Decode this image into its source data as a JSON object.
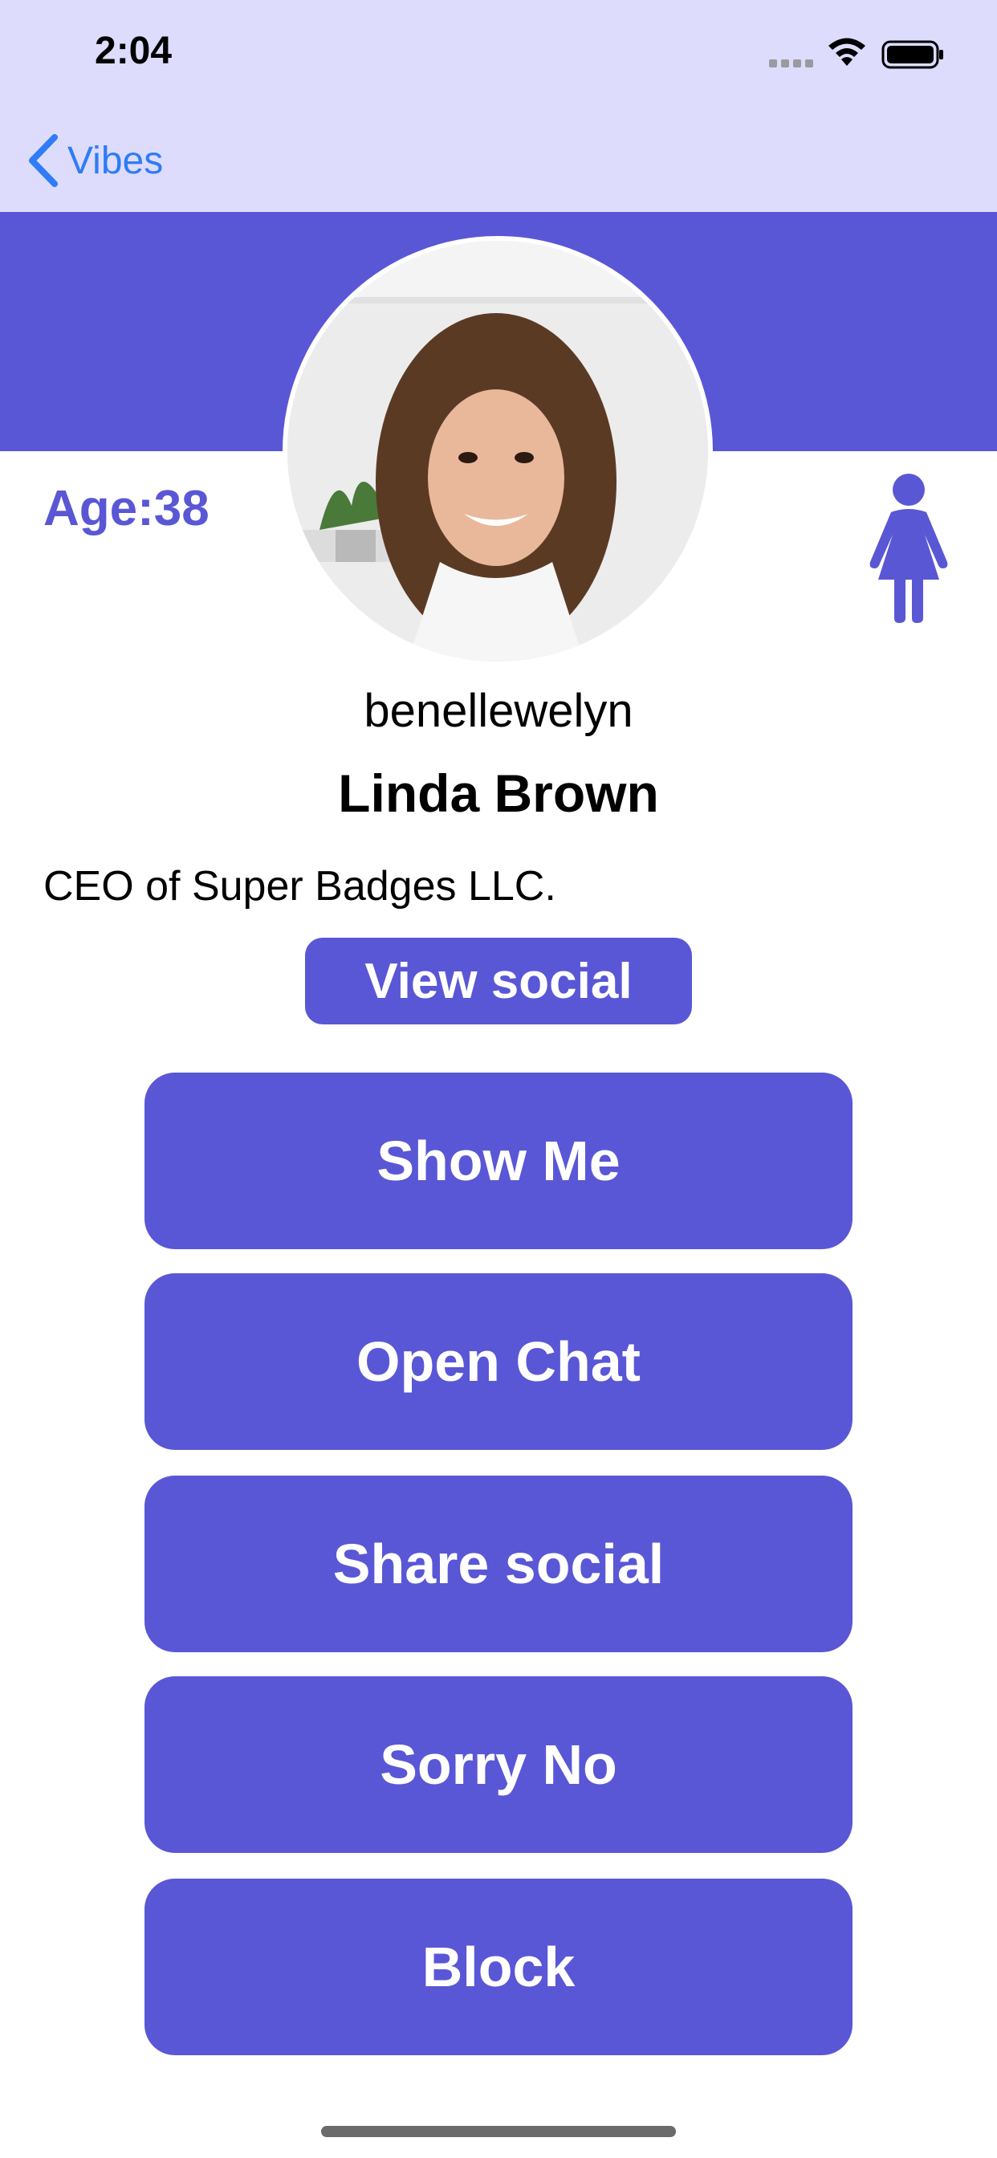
{
  "status_bar": {
    "time": "2:04"
  },
  "nav": {
    "back_label": "Vibes"
  },
  "profile": {
    "age_label": "Age:38",
    "gender_icon": "female-icon",
    "username": "benellewelyn",
    "full_name": "Linda Brown",
    "bio": "CEO of Super Badges LLC.",
    "view_social_label": "View social"
  },
  "actions": {
    "show_me": "Show Me",
    "open_chat": "Open Chat",
    "share_social": "Share social",
    "sorry_no": "Sorry No",
    "block": "Block"
  },
  "colors": {
    "accent": "#5957d6",
    "nav_background": "#dddcfd",
    "link_blue": "#2f7cf6"
  }
}
